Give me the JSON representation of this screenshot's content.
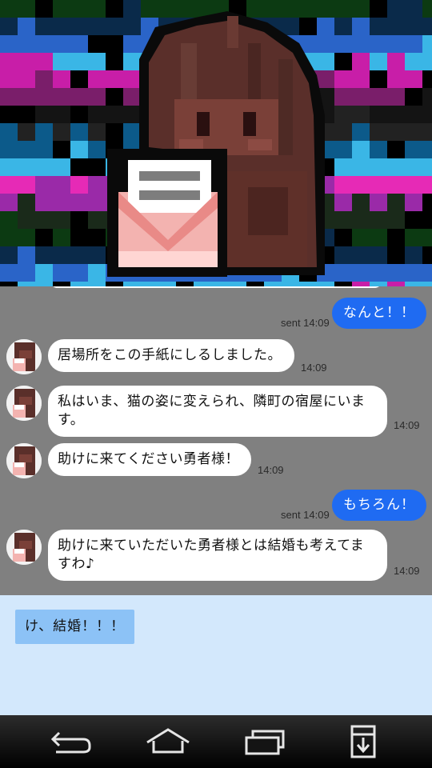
{
  "header": {
    "image": "pixel-art-portrait-girl-with-letter"
  },
  "messages": [
    {
      "side": "out",
      "text": "なんと！！",
      "status": "sent 14:09"
    },
    {
      "side": "in",
      "text": "居場所をこの手紙にしるしました。",
      "time": "14:09"
    },
    {
      "side": "in",
      "text": "私はいま、猫の姿に変えられ、隣町の宿屋にいます。",
      "time": "14:09"
    },
    {
      "side": "in",
      "text": "助けに来てください勇者様！",
      "time": "14:09"
    },
    {
      "side": "out",
      "text": "もちろん！",
      "status": "sent 14:09"
    },
    {
      "side": "in",
      "text": "助けに来ていただいた勇者様とは結婚も考えてますわ♪",
      "time": "14:09"
    }
  ],
  "composer": {
    "draft": "け、結婚！！！"
  },
  "navbar": {
    "icons": [
      "back-icon",
      "home-icon",
      "recent-apps-icon",
      "download-icon"
    ]
  },
  "colors": {
    "chat_bg": "#808080",
    "outgoing_bubble": "#1f6bf2",
    "incoming_bubble": "#ffffff",
    "composer_bg": "#d3e8fc",
    "draft_bg": "#8cc2f6"
  }
}
